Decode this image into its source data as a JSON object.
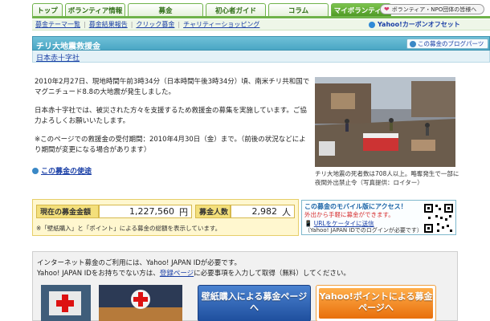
{
  "nav": {
    "tabs": [
      "トップ",
      "ボランティア情報",
      "募金",
      "初心者ガイド",
      "コラム",
      "マイボランティア"
    ],
    "active_index": 5,
    "volunteer_pill": "ボランティア・NPO団体の皆様へ"
  },
  "subnav": {
    "links": [
      "募金テーマ一覧",
      "募金結果報告",
      "クリック募金",
      "チャリティーショッピング"
    ],
    "yahoo_carbon": "Yahoo!カーボンオフセット"
  },
  "title": {
    "text": "チリ大地震救援金",
    "blog_button": "この募金のブログパーツ",
    "org_link": "日本赤十字社"
  },
  "body": {
    "p1": "2010年2月27日、現地時間午前3時34分（日本時間午後3時34分）頃、南米チリ共和国でマグニチュード8.8の大地震が発生しました。",
    "p2": "日本赤十字社では、被災された方々を支援するため救援金の募集を実施しています。ご協力よろしくお願いいたします。",
    "p3": "※このページでの救援金の受付期間：2010年4月30日（金）まで。（前後の状況などにより期間が変更になる場合があります）",
    "usage_link": "この募金の使途"
  },
  "photo": {
    "caption": "チリ大地震の死者数は708人以上。略奪発生で一部に夜間外出禁止令（写真提供：ロイター）"
  },
  "totals": {
    "amount_label": "現在の募金金額",
    "amount_value": "1,227,560",
    "amount_unit": "円",
    "count_label": "募金人数",
    "count_value": "2,982",
    "count_unit": "人",
    "note": "※「壁紙購入」と「ポイント」による募金の総額を表示しています。"
  },
  "mobile": {
    "title": "この募金のモバイル版にアクセス！",
    "subtitle": "外出から手軽に募金ができます。",
    "link": "URLをケータイに送信",
    "note": "（Yahoo! JAPAN IDでのログインが必要です）"
  },
  "bottom": {
    "line1": "インターネット募金のご利用には、Yahoo! JAPAN IDが必要です。",
    "line2_prefix": "Yahoo! JAPAN IDをお持ちでない方は、",
    "line2_link": "登録ページ",
    "line2_suffix": "に必要事項を入力して取得（無料）してください。",
    "cta_wallpaper": "壁紙購入による募金ページへ",
    "cta_points": "Yahoo!ポイントによる募金ページへ"
  },
  "colors": {
    "nav_green": "#6fb24a",
    "title_blue": "#4aa6c4",
    "totals_yellow": "#fff7cf",
    "cta_blue": "#2b5fb3",
    "cta_orange": "#f08a1c"
  }
}
